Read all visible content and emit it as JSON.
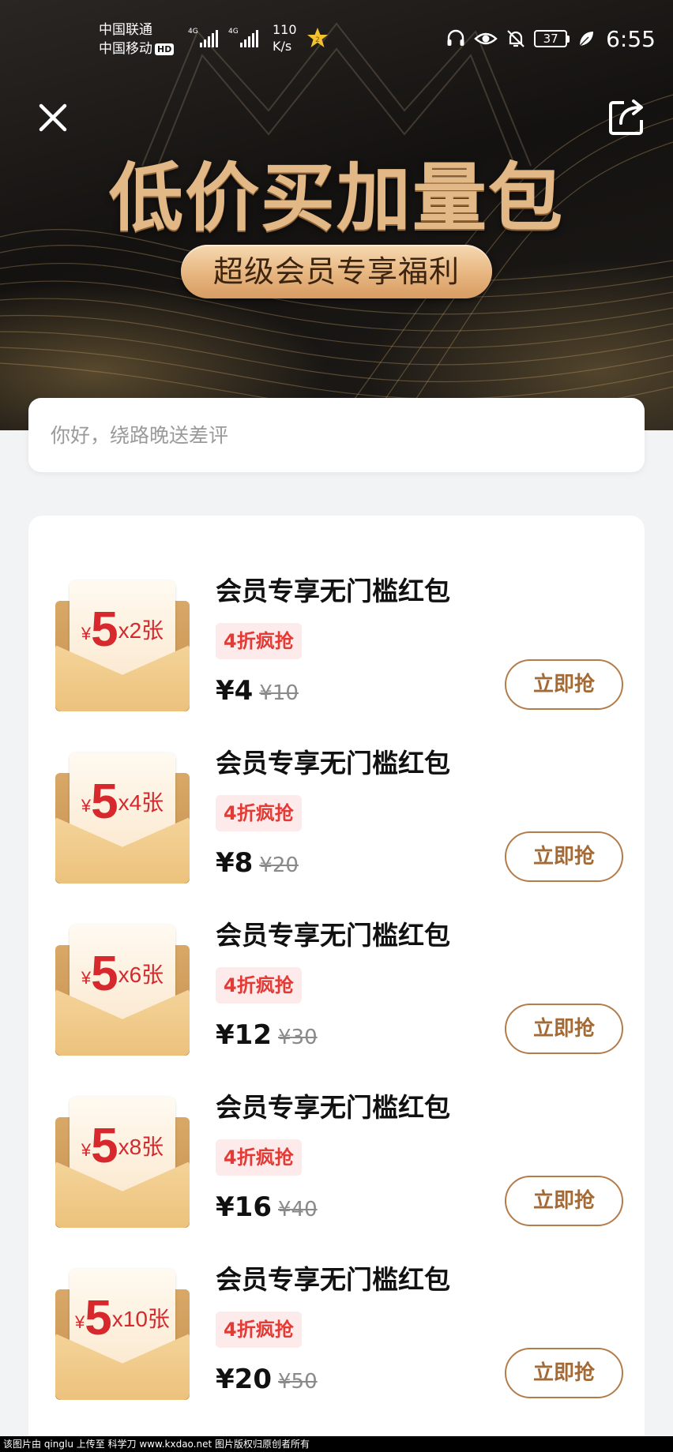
{
  "status_bar": {
    "carrier_1": "中国联通",
    "carrier_2": "中国移动",
    "hd_badge": "HD",
    "network_1": "4G",
    "network_2": "4G",
    "speed_value": "110",
    "speed_unit": "K/s",
    "battery": "37",
    "time": "6:55"
  },
  "header": {
    "title": "低价买加量包",
    "subtitle": "超级会员专享福利",
    "close_icon": "close-icon",
    "share_icon": "share-icon"
  },
  "search": {
    "placeholder": "你好，绕路晚送差评"
  },
  "colors": {
    "accent_gold": "#e2b887",
    "discount_red": "#e23b36",
    "button_border": "#b37c4a"
  },
  "items": [
    {
      "title": "会员专享无门槛红包",
      "tag": "4折疯抢",
      "price_now": "¥4",
      "price_old": "¥10",
      "button": "立即抢",
      "env_yen": "¥",
      "env_amount": "5",
      "env_count": "x2张"
    },
    {
      "title": "会员专享无门槛红包",
      "tag": "4折疯抢",
      "price_now": "¥8",
      "price_old": "¥20",
      "button": "立即抢",
      "env_yen": "¥",
      "env_amount": "5",
      "env_count": "x4张"
    },
    {
      "title": "会员专享无门槛红包",
      "tag": "4折疯抢",
      "price_now": "¥12",
      "price_old": "¥30",
      "button": "立即抢",
      "env_yen": "¥",
      "env_amount": "5",
      "env_count": "x6张"
    },
    {
      "title": "会员专享无门槛红包",
      "tag": "4折疯抢",
      "price_now": "¥16",
      "price_old": "¥40",
      "button": "立即抢",
      "env_yen": "¥",
      "env_amount": "5",
      "env_count": "x8张"
    },
    {
      "title": "会员专享无门槛红包",
      "tag": "4折疯抢",
      "price_now": "¥20",
      "price_old": "¥50",
      "button": "立即抢",
      "env_yen": "¥",
      "env_amount": "5",
      "env_count": "x10张"
    }
  ],
  "watermark": "该图片由 qinglu 上传至 科学刀 www.kxdao.net 图片版权归原创者所有"
}
